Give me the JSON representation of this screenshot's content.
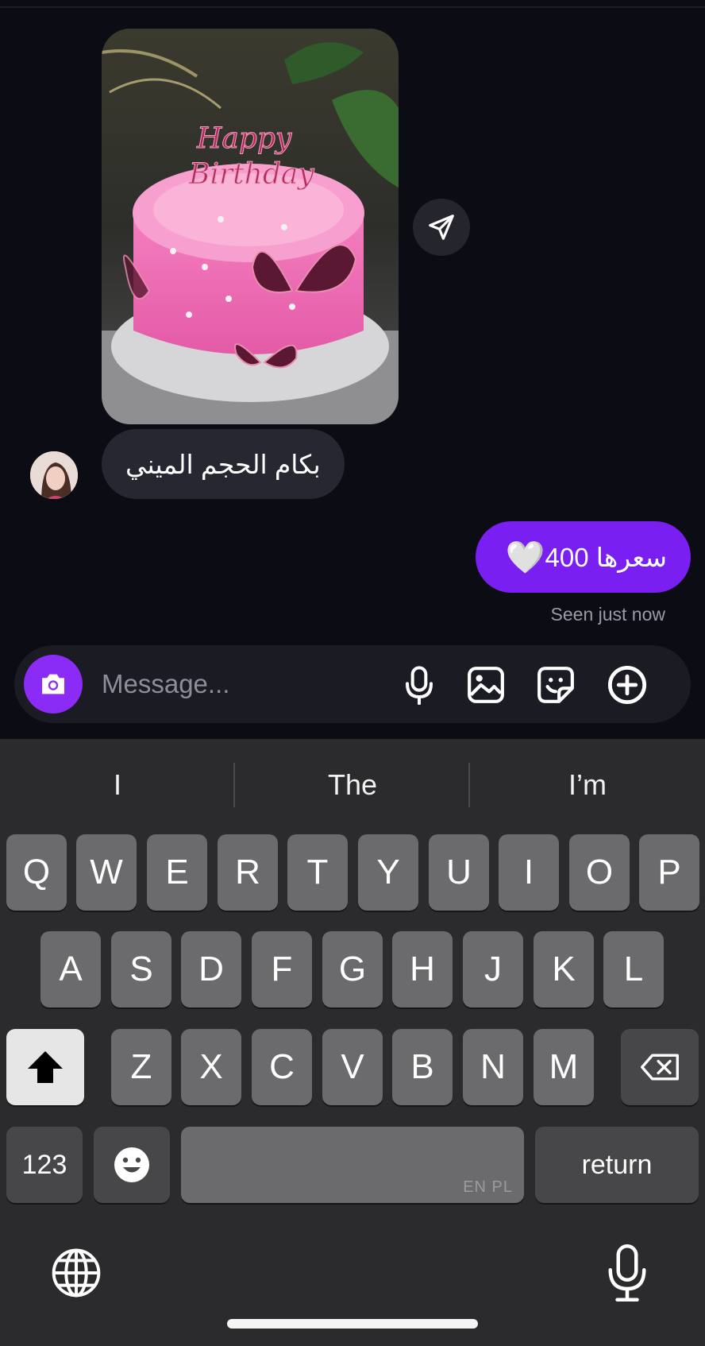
{
  "conversation": {
    "incoming_message": "بكام الحجم الميني",
    "outgoing_message": "سعرها 400",
    "outgoing_emoji": "🤍",
    "seen_status": "Seen just now",
    "photo_icon": "birthday-cake-photo",
    "share_icon": "send-icon",
    "avatar_icon": "contact-avatar"
  },
  "composer": {
    "placeholder": "Message...",
    "icons": [
      "camera-icon",
      "microphone-icon",
      "gallery-icon",
      "sticker-icon",
      "plus-circle-icon"
    ]
  },
  "keyboard": {
    "suggestions": [
      "I",
      "The",
      "I’m"
    ],
    "row1": [
      "Q",
      "W",
      "E",
      "R",
      "T",
      "Y",
      "U",
      "I",
      "O",
      "P"
    ],
    "row2": [
      "A",
      "S",
      "D",
      "F",
      "G",
      "H",
      "J",
      "K",
      "L"
    ],
    "row3": [
      "Z",
      "X",
      "C",
      "V",
      "B",
      "N",
      "M"
    ],
    "numbers_label": "123",
    "return_label": "return",
    "space_language_hint": "EN PL",
    "colors": {
      "key": "#6b6b6d",
      "function_key": "#474749",
      "shift_key": "#e6e6e7",
      "background": "#2b2b2d"
    }
  },
  "colors": {
    "accent": "#7a1ff2",
    "camera_button": "#8a2cf5",
    "incoming_bubble": "#262730",
    "background": "#0c0d14"
  }
}
